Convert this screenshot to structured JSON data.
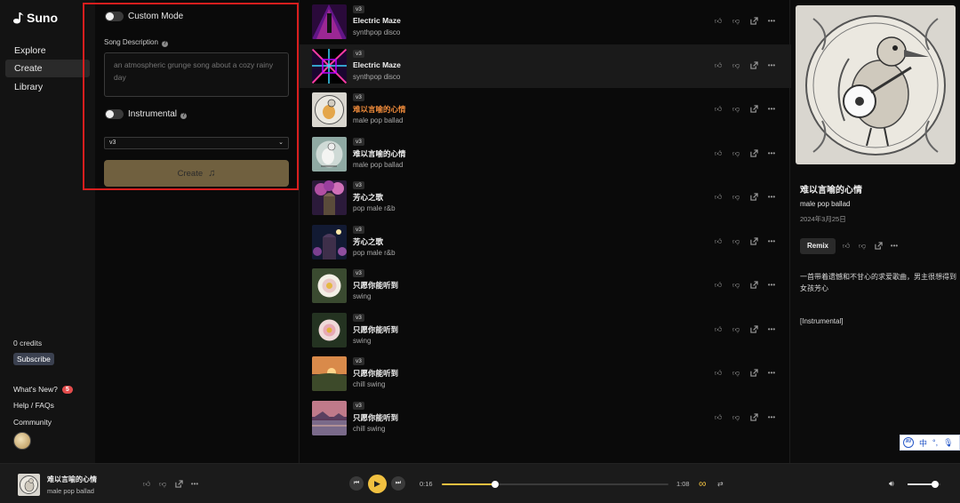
{
  "nav": {
    "logo": "Suno",
    "items": [
      {
        "label": "Explore"
      },
      {
        "label": "Create",
        "active": true
      },
      {
        "label": "Library"
      }
    ],
    "credits": "0 credits",
    "subscribe": "Subscribe",
    "whats_new": "What's New?",
    "whats_new_count": "5",
    "help": "Help / FAQs",
    "community": "Community"
  },
  "create": {
    "custom_mode": "Custom Mode",
    "song_description_label": "Song Description",
    "song_description_placeholder": "an atmospheric grunge song about a cozy rainy day",
    "instrumental": "Instrumental",
    "version": "v3",
    "create_button": "Create",
    "create_icon": "music-note-icon",
    "highlight_color": "#d81e1e"
  },
  "songs": [
    {
      "version": "v3",
      "title": "Electric Maze",
      "style": "synthpop disco",
      "art": "neon-figure"
    },
    {
      "version": "v3",
      "title": "Electric Maze",
      "style": "synthpop disco",
      "art": "neon-tunnel",
      "highlighted": true
    },
    {
      "version": "v3",
      "title": "难以言喻的心情",
      "style": "male pop ballad",
      "art": "bird-sketch",
      "active": true
    },
    {
      "version": "v3",
      "title": "难以言喻的心情",
      "style": "male pop ballad",
      "art": "bird-teal"
    },
    {
      "version": "v3",
      "title": "芳心之歌",
      "style": "pop male r&b",
      "art": "flower-arch"
    },
    {
      "version": "v3",
      "title": "芳心之歌",
      "style": "pop male r&b",
      "art": "night-garden"
    },
    {
      "version": "v3",
      "title": "只愿你能听到",
      "style": "swing",
      "art": "white-flower"
    },
    {
      "version": "v3",
      "title": "只愿你能听到",
      "style": "swing",
      "art": "pink-flower"
    },
    {
      "version": "v3",
      "title": "只愿你能听到",
      "style": "chill swing",
      "art": "sunset-field"
    },
    {
      "version": "v3",
      "title": "只愿你能听到",
      "style": "chill swing",
      "art": "sunset-lake"
    }
  ],
  "detail": {
    "title": "难以言喻的心情",
    "style": "male pop ballad",
    "date": "2024年3月25日",
    "remix": "Remix",
    "description": "一首带着遗憾和不甘心的求爱歌曲，男主很想得到女孩芳心",
    "instrumental_tag": "[Instrumental]"
  },
  "ime": {
    "lang": "中"
  },
  "player": {
    "title": "难以言喻的心情",
    "style": "male pop ballad",
    "current_time": "0:16",
    "total_time": "1:08",
    "progress": 0.235,
    "volume": 0.85,
    "accent": "#f0c040"
  }
}
